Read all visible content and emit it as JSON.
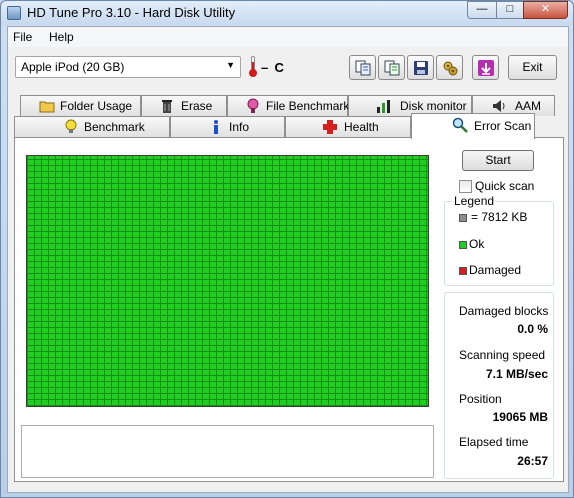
{
  "window": {
    "title": "HD Tune Pro 3.10 - Hard Disk Utility",
    "caption_buttons": {
      "minimize": "—",
      "maximize": "□",
      "close": "✕"
    }
  },
  "menu": {
    "file": "File",
    "help": "Help"
  },
  "toolbar": {
    "drive": "Apple   iPod (20 GB)",
    "temperature": "–  C",
    "exit_label": "Exit",
    "icons": [
      "copy-info-icon",
      "copy-all-icon",
      "save-icon",
      "options-icon",
      "screenshot-icon"
    ]
  },
  "tabs": {
    "row_top": [
      {
        "label": "Folder Usage",
        "icon": "folder-icon"
      },
      {
        "label": "Erase",
        "icon": "trash-icon"
      },
      {
        "label": "File Benchmark",
        "icon": "file-benchmark-icon"
      },
      {
        "label": "Disk monitor",
        "icon": "disk-monitor-icon"
      },
      {
        "label": "AAM",
        "icon": "speaker-icon"
      }
    ],
    "row_bottom": [
      {
        "label": "Benchmark",
        "icon": "lightbulb-icon"
      },
      {
        "label": "Info",
        "icon": "info-icon"
      },
      {
        "label": "Health",
        "icon": "health-cross-icon"
      },
      {
        "label": "Error Scan",
        "icon": "magnifier-icon",
        "active": true
      }
    ]
  },
  "error_scan": {
    "start_label": "Start",
    "quick_scan_label": "Quick scan",
    "quick_scan_checked": false,
    "legend": {
      "title": "Legend",
      "block_size": "= 7812 KB",
      "ok": "Ok",
      "damaged": "Damaged",
      "colors": {
        "block": "#8c8c8c",
        "ok": "#21cf21",
        "damaged": "#d62020"
      }
    },
    "stats": {
      "damaged_blocks_label": "Damaged blocks",
      "damaged_blocks_value": "0.0 %",
      "scanning_speed_label": "Scanning speed",
      "scanning_speed_value": "7.1 MB/sec",
      "position_label": "Position",
      "position_value": "19065 MB",
      "elapsed_time_label": "Elapsed time",
      "elapsed_time_value": "26:57"
    },
    "grid_status": "all blocks ok"
  }
}
